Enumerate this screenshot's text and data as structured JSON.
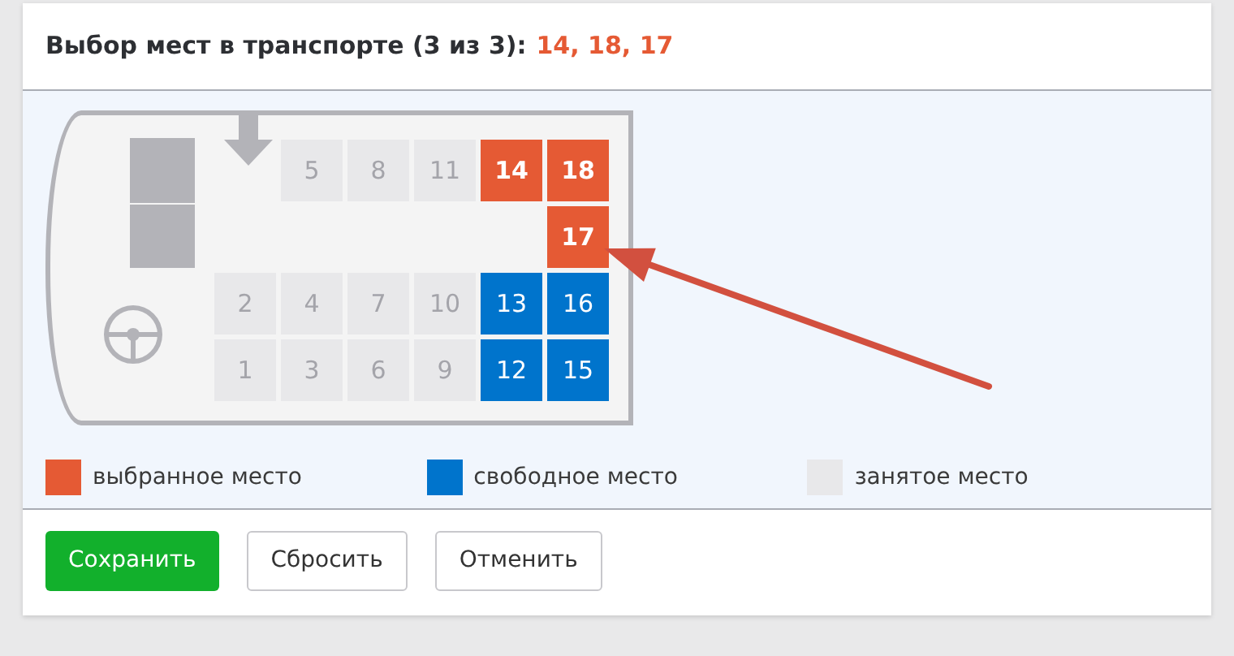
{
  "header": {
    "title": "Выбор мест в транспорте (3 из 3):",
    "selected_seats": "14, 18, 17"
  },
  "seat_rows": [
    [
      {
        "kind": "gap"
      },
      {
        "kind": "seat",
        "number": "5",
        "selected": false,
        "occupied": true
      },
      {
        "kind": "seat",
        "number": "8",
        "selected": false,
        "occupied": true
      },
      {
        "kind": "seat",
        "number": "11",
        "selected": false,
        "occupied": true
      },
      {
        "kind": "seat",
        "number": "14",
        "selected": true,
        "occupied": false
      },
      {
        "kind": "seat",
        "number": "18",
        "selected": true,
        "occupied": false
      }
    ],
    [
      {
        "kind": "gap"
      },
      {
        "kind": "gap"
      },
      {
        "kind": "gap"
      },
      {
        "kind": "gap"
      },
      {
        "kind": "gap"
      },
      {
        "kind": "seat",
        "number": "17",
        "selected": true,
        "occupied": false
      }
    ],
    [
      {
        "kind": "seat",
        "number": "2",
        "selected": false,
        "occupied": true
      },
      {
        "kind": "seat",
        "number": "4",
        "selected": false,
        "occupied": true
      },
      {
        "kind": "seat",
        "number": "7",
        "selected": false,
        "occupied": true
      },
      {
        "kind": "seat",
        "number": "10",
        "selected": false,
        "occupied": true
      },
      {
        "kind": "seat",
        "number": "13",
        "selected": false,
        "occupied": false
      },
      {
        "kind": "seat",
        "number": "16",
        "selected": false,
        "occupied": false
      }
    ],
    [
      {
        "kind": "seat",
        "number": "1",
        "selected": false,
        "occupied": true
      },
      {
        "kind": "seat",
        "number": "3",
        "selected": false,
        "occupied": true
      },
      {
        "kind": "seat",
        "number": "6",
        "selected": false,
        "occupied": true
      },
      {
        "kind": "seat",
        "number": "9",
        "selected": false,
        "occupied": true
      },
      {
        "kind": "seat",
        "number": "12",
        "selected": false,
        "occupied": false
      },
      {
        "kind": "seat",
        "number": "15",
        "selected": false,
        "occupied": false
      }
    ]
  ],
  "legend": [
    {
      "kind": "selected",
      "label": "выбранное место"
    },
    {
      "kind": "free",
      "label": "свободное место"
    },
    {
      "kind": "occupied",
      "label": "занятое место"
    }
  ],
  "buttons": [
    {
      "kind": "primary",
      "label": "Сохранить"
    },
    {
      "kind": "secondary",
      "label": "Сбросить"
    },
    {
      "kind": "secondary",
      "label": "Отменить"
    }
  ]
}
